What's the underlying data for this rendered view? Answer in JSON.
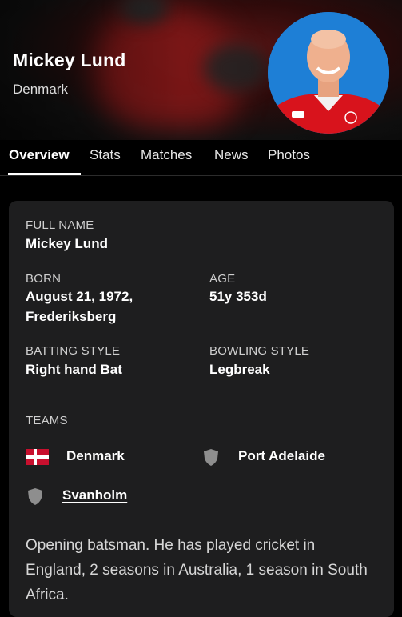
{
  "player": {
    "name": "Mickey Lund",
    "country": "Denmark"
  },
  "tabs": [
    "Overview",
    "Stats",
    "Matches",
    "News",
    "Photos"
  ],
  "overview": {
    "full_name_label": "FULL NAME",
    "full_name": "Mickey Lund",
    "born_label": "BORN",
    "born_line1": "August 21, 1972,",
    "born_line2": "Frederiksberg",
    "age_label": "AGE",
    "age": "51y 353d",
    "batting_label": "BATTING STYLE",
    "batting": "Right hand Bat",
    "bowling_label": "BOWLING STYLE",
    "bowling": "Legbreak",
    "teams_label": "TEAMS",
    "teams": [
      "Denmark",
      "Port Adelaide",
      "Svanholm"
    ],
    "bio": "Opening batsman. He has played cricket in England, 2 seasons in Australia, 1 season in South Africa."
  },
  "colors": {
    "background": "#000000",
    "card": "#1e1e1f",
    "avatar_bg": "#1e7fd6",
    "flag_red": "#c8102e"
  },
  "icons": [
    "denmark-flag-icon",
    "team-shield-icon"
  ]
}
